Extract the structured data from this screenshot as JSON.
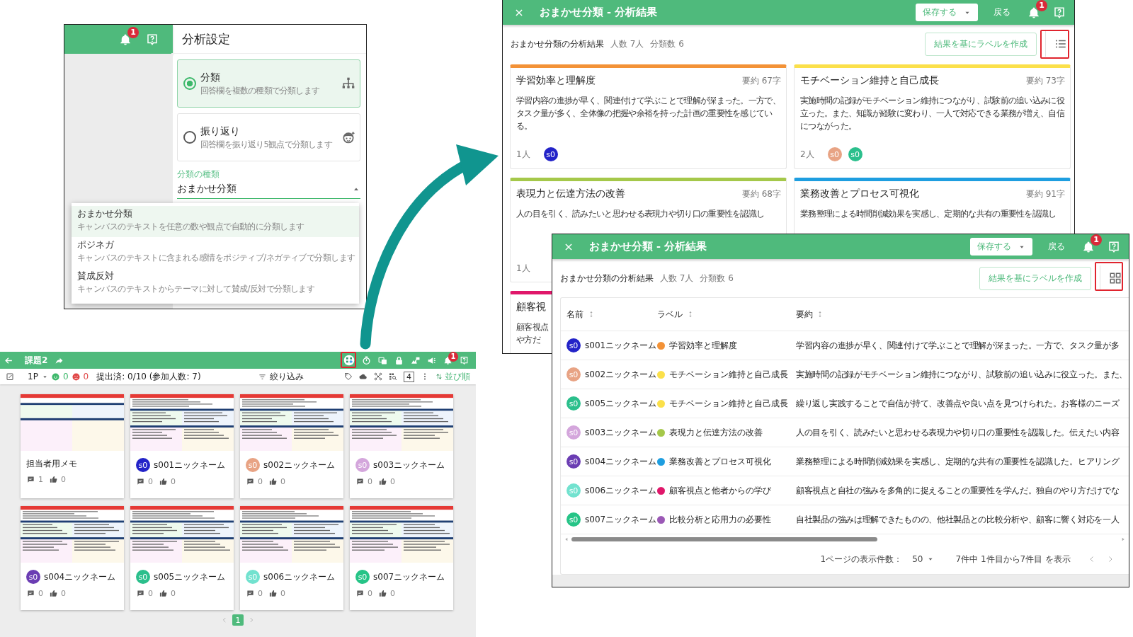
{
  "settings_panel": {
    "notification_count": "1",
    "title": "分析設定",
    "options": [
      {
        "kind": "tree",
        "title": "分類",
        "description": "回答欄を複数の種類で分類します",
        "selected": true
      },
      {
        "kind": "face",
        "title": "振り返り",
        "description": "回答欄を振り返り5観点で分類します",
        "selected": false
      }
    ],
    "type_field": {
      "label": "分類の種類",
      "value": "おまかせ分類"
    },
    "menu": [
      {
        "title": "おまかせ分類",
        "description": "キャンバスのテキストを任意の数や観点で自動的に分類します",
        "selected": true
      },
      {
        "title": "ポジネガ",
        "description": "キャンバスのテキストに含まれる感情をポジティブ/ネガティブで分類します",
        "selected": false
      },
      {
        "title": "賛成反対",
        "description": "キャンバスのテキストからテーマに対して賛成/反対で分類します",
        "selected": false
      }
    ]
  },
  "canvas_app": {
    "title": "課題2",
    "notification_count": "1",
    "page": "1P",
    "positive_count": "0",
    "negative_count": "0",
    "submitted": "提出済: 0/10 (参加人数: 7)",
    "filter": "絞り込み",
    "column_count": "4",
    "sort": "並び順",
    "cards": [
      {
        "name": "担当者用メモ",
        "comments": "1",
        "likes": "0"
      },
      {
        "avatar": "s0",
        "color": "#2323c8",
        "name": "s001ニックネーム",
        "comments": "0",
        "likes": "0"
      },
      {
        "avatar": "s0",
        "color": "#e8a384",
        "name": "s002ニックネーム",
        "comments": "0",
        "likes": "0"
      },
      {
        "avatar": "s0",
        "color": "#d4a6dc",
        "name": "s003ニックネーム",
        "comments": "0",
        "likes": "0"
      },
      {
        "avatar": "s0",
        "color": "#6b3db3",
        "name": "s004ニックネーム",
        "comments": "0",
        "likes": "0"
      },
      {
        "avatar": "s0",
        "color": "#2bbf8c",
        "name": "s005ニックネーム",
        "comments": "0",
        "likes": "0"
      },
      {
        "avatar": "s0",
        "color": "#72e2cf",
        "name": "s006ニックネーム",
        "comments": "0",
        "likes": "0"
      },
      {
        "avatar": "s0",
        "color": "#26c487",
        "name": "s007ニックネーム",
        "comments": "0",
        "likes": "0"
      }
    ],
    "pages": [
      {
        "label": "1",
        "selected": true
      }
    ]
  },
  "grid_result": {
    "title": "おまかせ分類 - 分析結果",
    "save": "保存する",
    "back": "戻る",
    "notification_count": "1",
    "summary_title": "おまかせ分類の分析結果",
    "people": "人数 7人",
    "categories": "分類数 6",
    "create_label": "結果を基にラベルを作成",
    "cards": [
      {
        "title": "学習効率と理解度",
        "length": "要約 67字",
        "color": "#f39237",
        "lines": [
          "学習内容の進捗が早く、関連付けて学ぶことで理解が深まった。一方で、タスク量が多く、全体像の把握や余裕を持った計画の重要性を感じている。"
        ],
        "count": "1人",
        "members": [
          {
            "label": "s0",
            "color": "#2323c8"
          }
        ]
      },
      {
        "title": "モチベーション維持と自己成長",
        "length": "要約 73字",
        "color": "#fbe04a",
        "lines": [
          "実施時間の記録がモチベーション維持につながり、試験前の追い込みに役立った。また、知識が経験に変わり、一人で対応できる業務が増え、自信につながった。"
        ],
        "count": "2人",
        "members": [
          {
            "label": "s0",
            "color": "#e8a384"
          },
          {
            "label": "s0",
            "color": "#2bbf8c"
          }
        ]
      },
      {
        "title": "表現力と伝達方法の改善",
        "length": "要約 68字",
        "color": "#a5c84a",
        "lines": [
          "人の目を引く、読みたいと思わせる表現力や切り口の重要性を認識し"
        ],
        "count": "1人"
      },
      {
        "title": "業務改善とプロセス可視化",
        "length": "要約 91字",
        "color": "#1e9ee0",
        "lines": [
          "業務整理による時間削減効果を実感し、定期的な共有の重要性を認識し"
        ]
      },
      {
        "title": "顧客視",
        "color": "#e0176a",
        "lines": [
          "顧客視点",
          "や方だ"
        ]
      }
    ]
  },
  "table_result": {
    "title": "おまかせ分類 - 分析結果",
    "save": "保存する",
    "back": "戻る",
    "notification_count": "1",
    "summary_title": "おまかせ分類の分析結果",
    "people": "人数 7人",
    "categories": "分類数 6",
    "create_label": "結果を基にラベルを作成",
    "columns": [
      "名前",
      "ラベル",
      "要約"
    ],
    "rows": [
      {
        "avatar": "s0",
        "color": "#2323c8",
        "name": "s001ニックネーム",
        "label": {
          "text": "学習効率と理解度",
          "color": "#f39237"
        },
        "summary": "学習内容の進捗が早く、関連付けて学ぶことで理解が深まった。一方で、タスク量が多"
      },
      {
        "avatar": "s0",
        "color": "#e8a384",
        "name": "s002ニックネーム",
        "label": {
          "text": "モチベーション維持と自己成長",
          "color": "#fbe04a"
        },
        "summary": "実施時間の記録がモチベーション維持につながり、試験前の追い込みに役立った。また、"
      },
      {
        "avatar": "s0",
        "color": "#2bbf8c",
        "name": "s005ニックネーム",
        "label": {
          "text": "モチベーション維持と自己成長",
          "color": "#fbe04a"
        },
        "summary": "繰り返し実践することで自信が持て、改善点や良い点を見つけられた。お客様のニーズ"
      },
      {
        "avatar": "s0",
        "color": "#d4a6dc",
        "name": "s003ニックネーム",
        "label": {
          "text": "表現力と伝達方法の改善",
          "color": "#a5c84a"
        },
        "summary": "人の目を引く、読みたいと思わせる表現力や切り口の重要性を認識した。伝えたい内容"
      },
      {
        "avatar": "s0",
        "color": "#6b3db3",
        "name": "s004ニックネーム",
        "label": {
          "text": "業務改善とプロセス可視化",
          "color": "#1e9ee0"
        },
        "summary": "業務整理による時間削減効果を実感し、定期的な共有の重要性を認識した。ヒアリング"
      },
      {
        "avatar": "s0",
        "color": "#72e2cf",
        "name": "s006ニックネーム",
        "label": {
          "text": "顧客視点と他者からの学び",
          "color": "#e0176a"
        },
        "summary": "顧客視点と自社の強みを多角的に捉えることの重要性を学んだ。独自のやり方だけでな"
      },
      {
        "avatar": "s0",
        "color": "#26c487",
        "name": "s007ニックネーム",
        "label": {
          "text": "比較分析と応用力の必要性",
          "color": "#9b59b6"
        },
        "summary": "自社製品の強みは理解できたものの、他社製品との比較分析や、顧客に響く対応を一人"
      }
    ],
    "per_page_label": "1ページの表示件数：",
    "per_page": "50",
    "range": "7件中 1件目から7件目 を表示"
  }
}
